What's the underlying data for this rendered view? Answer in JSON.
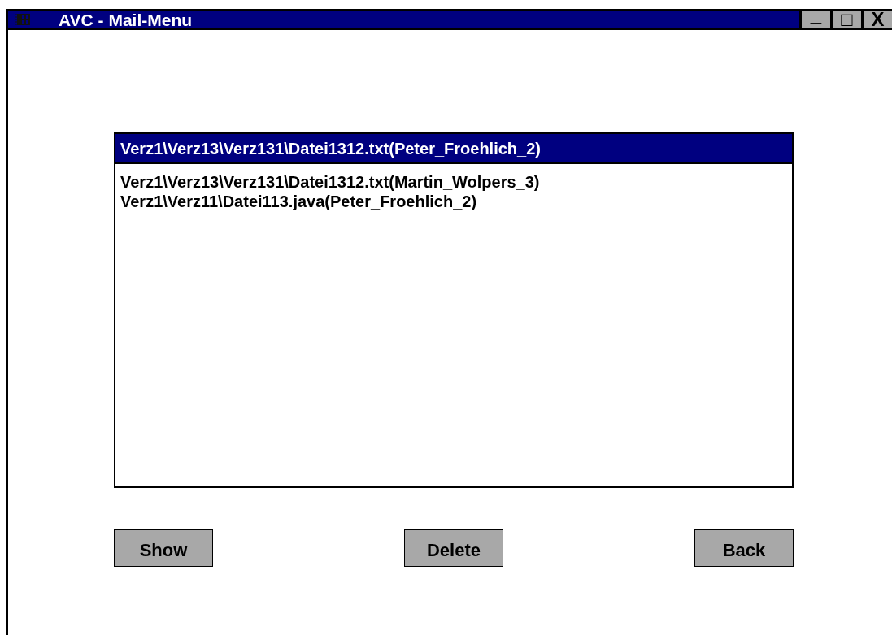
{
  "window": {
    "title": "AVC - Mail-Menu",
    "controls": [
      "_",
      "□",
      "X"
    ]
  },
  "list": {
    "items": [
      {
        "label": "Verz1\\Verz13\\Verz131\\Datei1312.txt(Peter_Froehlich_2)",
        "selected": true
      },
      {
        "label": "Verz1\\Verz13\\Verz131\\Datei1312.txt(Martin_Wolpers_3)",
        "selected": false
      },
      {
        "label": "Verz1\\Verz11\\Datei113.java(Peter_Froehlich_2)",
        "selected": false
      }
    ]
  },
  "buttons": [
    "Show",
    "Delete",
    "Back"
  ]
}
